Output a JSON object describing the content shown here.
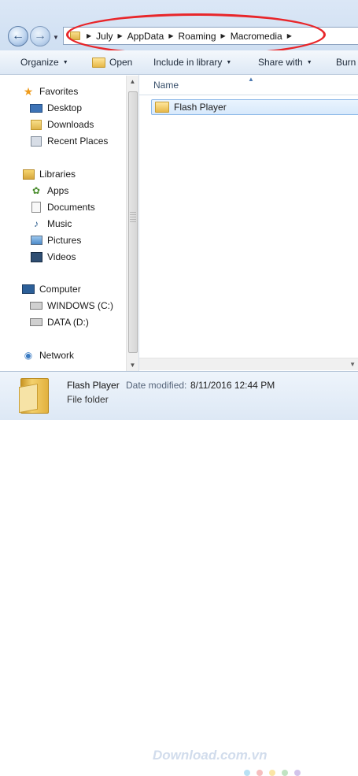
{
  "address_bar": {
    "nav_back_icon": "back-arrow-icon",
    "nav_forward_icon": "forward-arrow-icon",
    "dropdown_icon": "chevron-down-icon",
    "breadcrumbs": [
      "July",
      "AppData",
      "Roaming",
      "Macromedia"
    ]
  },
  "toolbar": {
    "organize": "Organize",
    "open": "Open",
    "include_in_library": "Include in library",
    "share_with": "Share with",
    "burn": "Burn"
  },
  "sidebar": {
    "favorites_label": "Favorites",
    "favorites": [
      "Desktop",
      "Downloads",
      "Recent Places"
    ],
    "libraries_label": "Libraries",
    "libraries": [
      "Apps",
      "Documents",
      "Music",
      "Pictures",
      "Videos"
    ],
    "computer_label": "Computer",
    "computer": [
      "WINDOWS (C:)",
      "DATA (D:)"
    ],
    "network_label": "Network"
  },
  "content": {
    "column_name": "Name",
    "items": [
      "Flash Player"
    ]
  },
  "details": {
    "name": "Flash Player",
    "type": "File folder",
    "date_label": "Date modified:",
    "date_value": "8/11/2016 12:44 PM"
  },
  "watermark": {
    "text": "Download.com.vn"
  },
  "colors": {
    "highlight": "#e8262a",
    "accent": "#8cb8e8",
    "folder": "#e7b84a"
  }
}
